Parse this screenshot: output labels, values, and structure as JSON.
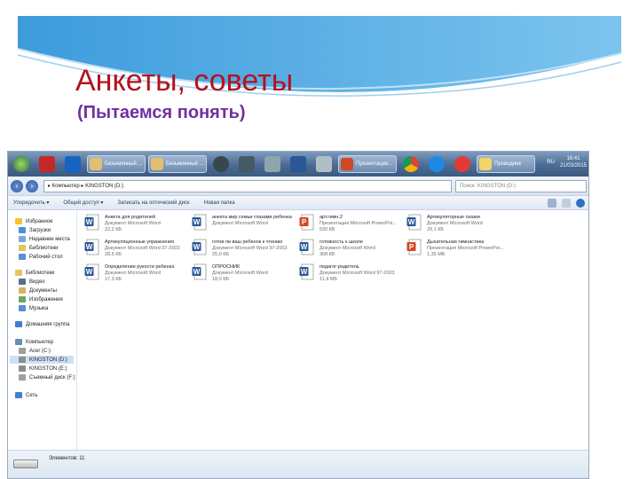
{
  "slide": {
    "title": "Анкеты, советы",
    "subtitle": "(Пытаемся понять)"
  },
  "colors": {
    "title": "#b5121b",
    "subtitle": "#7030a0",
    "wave": "#5aaee3",
    "taskbar": "#4a6b93",
    "word_icon": "#2b5797",
    "ppt_icon": "#d24726"
  },
  "taskbar": {
    "windows": [
      {
        "label": "Безымянный ...",
        "icon": "paint-icon"
      },
      {
        "label": "Безымянный ...",
        "icon": "paint-icon"
      },
      {
        "label": "Презентация...",
        "icon": "powerpoint-icon"
      },
      {
        "label": "Проводник",
        "icon": "explorer-icon"
      }
    ],
    "lang": "RU",
    "time": "18:41",
    "date": "21/03/2015"
  },
  "explorer": {
    "address": "▸ Компьютер ▸ KINGSTON (D:)",
    "search_placeholder": "Поиск: KINGSTON (D:)",
    "toolbar": [
      "Упорядочить ▾",
      "Общий доступ ▾",
      "Записать на оптический диск",
      "Новая папка"
    ],
    "nav": [
      {
        "label": "Избранное",
        "icon": "star-icon",
        "level": 0
      },
      {
        "label": "Загрузки",
        "icon": "downloads-icon",
        "level": 1
      },
      {
        "label": "Недавние места",
        "icon": "recent-places-icon",
        "level": 1
      },
      {
        "label": "Библиотеки",
        "icon": "library-icon",
        "level": 1
      },
      {
        "label": "Рабочий стол",
        "icon": "desktop-icon",
        "level": 1
      },
      {
        "label": "Библиотеки",
        "icon": "library-icon",
        "level": 0
      },
      {
        "label": "Видео",
        "icon": "video-icon",
        "level": 1
      },
      {
        "label": "Документы",
        "icon": "documents-icon",
        "level": 1
      },
      {
        "label": "Изображения",
        "icon": "images-icon",
        "level": 1
      },
      {
        "label": "Музыка",
        "icon": "music-icon",
        "level": 1
      },
      {
        "label": "Домашняя группа",
        "icon": "homegroup-icon",
        "level": 0
      },
      {
        "label": "Компьютер",
        "icon": "computer-icon",
        "level": 0
      },
      {
        "label": "Acer (C:)",
        "icon": "drive-icon",
        "level": 1
      },
      {
        "label": "KINGSTON (D:)",
        "icon": "usb-drive-icon",
        "level": 1,
        "selected": true
      },
      {
        "label": "KINGSTON (E:)",
        "icon": "usb-drive-icon",
        "level": 1
      },
      {
        "label": "Съемный диск (F:)",
        "icon": "removable-drive-icon",
        "level": 1
      },
      {
        "label": "Сеть",
        "icon": "network-icon",
        "level": 0
      }
    ],
    "files": [
      {
        "name": "Анкета для родителей",
        "type": "Документ Microsoft Word",
        "size": "22,2 КБ",
        "icon": "word-icon"
      },
      {
        "name": "анкета мир семьи глазами ребенка",
        "type": "Документ Microsoft Word",
        "size": "",
        "icon": "word-icon"
      },
      {
        "name": "арт.гимн.2",
        "type": "Презентация Microsoft PowerPoi...",
        "size": "530 КБ",
        "icon": "powerpoint-icon"
      },
      {
        "name": "Артикуляторные сказки",
        "type": "Документ Microsoft Word",
        "size": "29,1 КБ",
        "icon": "word-icon"
      },
      {
        "name": "Артикуляционные упражнения",
        "type": "Документ Microsoft Word 97-2003",
        "size": "28,5 КБ",
        "icon": "word-icon"
      },
      {
        "name": "готов ли ваш ребенок к чтению",
        "type": "Документ Microsoft Word 97-2003",
        "size": "25,0 КБ",
        "icon": "word-icon"
      },
      {
        "name": "готовность к школе",
        "type": "Документ Microsoft Word",
        "size": "308 КБ",
        "icon": "word-icon"
      },
      {
        "name": "Дыхательная гимнастика",
        "type": "Презентация Microsoft PowerPoi...",
        "size": "1,35 МБ",
        "icon": "powerpoint-icon"
      },
      {
        "name": "Определение рукости ребенка",
        "type": "Документ Microsoft Word",
        "size": "17,3 КБ",
        "icon": "word-icon"
      },
      {
        "name": "ОПРОСНИК",
        "type": "Документ Microsoft Word",
        "size": "18,0 КБ",
        "icon": "word-icon"
      },
      {
        "name": "педагог-родитель",
        "type": "Документ Microsoft Word 97-2003",
        "size": "11,4 МБ",
        "icon": "word-icon"
      }
    ],
    "status": "Элементов: 11"
  }
}
